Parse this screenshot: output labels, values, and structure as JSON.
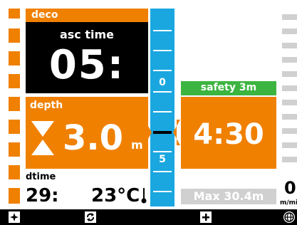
{
  "colors": {
    "accent_orange": "#f08000",
    "scale_blue": "#1aa7e0",
    "safety_green": "#3cb440",
    "max_grey": "#d0d0d0",
    "background": "#ffffff",
    "panel_black": "#000000"
  },
  "deco": {
    "label": "deco",
    "asc_time_label": "asc time",
    "asc_time_value": "05:"
  },
  "depth": {
    "label": "depth",
    "value": "3.0",
    "unit": "m",
    "icon": "hourglass-icon"
  },
  "dive": {
    "dtime_label": "dtime",
    "dtime_value": "29:",
    "temperature": "23°C",
    "temperature_icon": "thermometer-icon"
  },
  "scale": {
    "labels": [
      "0",
      "5"
    ]
  },
  "safety_stop": {
    "label": "safety 3m",
    "time": "4:30"
  },
  "max_depth": {
    "label": "Max 30.4m"
  },
  "ascent_speed": {
    "value": "0",
    "unit": "m/mi"
  },
  "bottom_buttons": [
    {
      "name": "sparkle-icon"
    },
    {
      "name": "cycle-icon"
    },
    {
      "name": "plus-icon"
    },
    {
      "name": "globe-icon"
    }
  ]
}
